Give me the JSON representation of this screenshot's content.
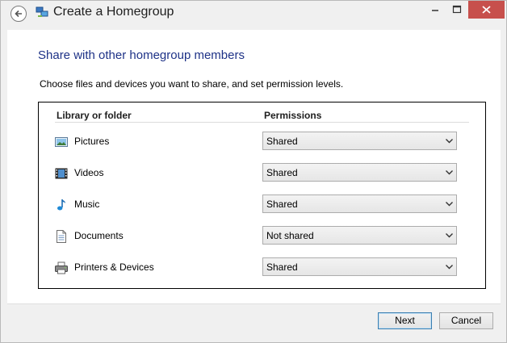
{
  "window": {
    "title": "Create a Homegroup",
    "close_color": "#c7504c"
  },
  "page": {
    "heading": "Share with other homegroup members",
    "instructions": "Choose files and devices you want to share, and set permission levels."
  },
  "table": {
    "columns": [
      "Library or folder",
      "Permissions"
    ],
    "rows": [
      {
        "label": "Pictures",
        "icon": "pictures-icon",
        "permission": "Shared"
      },
      {
        "label": "Videos",
        "icon": "videos-icon",
        "permission": "Shared"
      },
      {
        "label": "Music",
        "icon": "music-icon",
        "permission": "Shared"
      },
      {
        "label": "Documents",
        "icon": "documents-icon",
        "permission": "Not shared"
      },
      {
        "label": "Printers & Devices",
        "icon": "printer-icon",
        "permission": "Shared"
      }
    ]
  },
  "buttons": {
    "next": "Next",
    "cancel": "Cancel"
  },
  "colors": {
    "heading": "#1e3287",
    "accent": "#3c7fb1"
  }
}
